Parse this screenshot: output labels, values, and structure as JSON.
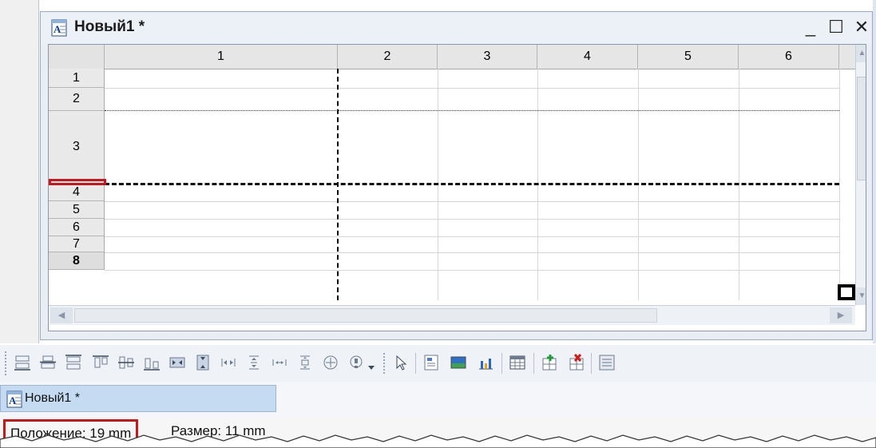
{
  "window": {
    "title": "Новый1 *",
    "minimize_symbol": "_",
    "maximize_symbol": "☐",
    "close_symbol": "✕"
  },
  "sheet": {
    "columns": [
      "1",
      "2",
      "3",
      "4",
      "5",
      "6"
    ],
    "rows": [
      "1",
      "2",
      "3",
      "4",
      "5",
      "6",
      "7",
      "8"
    ],
    "active_row": "8"
  },
  "toolbar": {
    "icons": [
      "align-bottom-icon",
      "align-center-horizontal-icon",
      "align-top-icon",
      "align-left-icon",
      "align-center-vertical-icon",
      "align-right-icon",
      "center-horizontal-icon",
      "center-vertical-icon",
      "distribute-horizontal-icon",
      "distribute-vertical-icon",
      "space-horizontal-icon",
      "space-vertical-icon",
      "merge-cells-icon",
      "unmerge-cells-icon",
      "dropdown-arrow-icon",
      "pointer-icon",
      "text-field-icon",
      "picture-icon",
      "chart-icon",
      "table-icon",
      "insert-cell-icon",
      "delete-cell-icon",
      "overflow-icon"
    ]
  },
  "tabbar": {
    "tab_label": "Новый1 *"
  },
  "statusbar": {
    "position": "Положение: 19 mm",
    "size": "Размер: 11 mm"
  },
  "colors": {
    "highlight_red": "#c8161d",
    "tab_blue": "#c4dbf2",
    "chart_icon_blue": "#2b63c0",
    "delete_icon_red": "#d01b1b"
  }
}
